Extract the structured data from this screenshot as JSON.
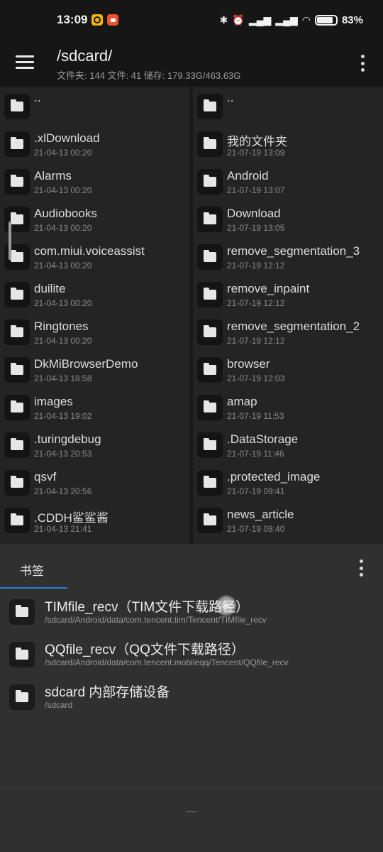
{
  "status_bar": {
    "time": "13:09",
    "icons": [
      "bluetooth-icon",
      "alarm-icon",
      "signal-hd-icon",
      "signal-hd-icon",
      "wifi-icon",
      "battery-icon"
    ],
    "battery_text": "83%",
    "battery_level": 0.83
  },
  "header": {
    "title": "/sdcard/",
    "subtitle": "文件夹: 144   文件: 41   储存: 179.33G/463.63G"
  },
  "left_column": [
    {
      "name": "..",
      "date": ""
    },
    {
      "name": ".xlDownload",
      "date": "21-04-13 00:20"
    },
    {
      "name": "Alarms",
      "date": "21-04-13 00:20"
    },
    {
      "name": "Audiobooks",
      "date": "21-04-13 00:20"
    },
    {
      "name": "com.miui.voiceassist",
      "date": "21-04-13 00:20"
    },
    {
      "name": "duilite",
      "date": "21-04-13 00:20"
    },
    {
      "name": "Ringtones",
      "date": "21-04-13 00:20"
    },
    {
      "name": "DkMiBrowserDemo",
      "date": "21-04-13 18:58"
    },
    {
      "name": "images",
      "date": "21-04-13 19:02"
    },
    {
      "name": ".turingdebug",
      "date": "21-04-13 20:53"
    },
    {
      "name": "qsvf",
      "date": "21-04-13 20:56"
    },
    {
      "name": ".CDDH鲨鲨酱",
      "date": "21-04-13 21:41"
    }
  ],
  "right_column": [
    {
      "name": "..",
      "date": ""
    },
    {
      "name": "我的文件夹",
      "date": "21-07-19 13:09"
    },
    {
      "name": "Android",
      "date": "21-07-19 13:07"
    },
    {
      "name": "Download",
      "date": "21-07-19 13:05"
    },
    {
      "name": "remove_segmentation_3",
      "date": "21-07-19 12:12"
    },
    {
      "name": "remove_inpaint",
      "date": "21-07-19 12:12"
    },
    {
      "name": "remove_segmentation_2",
      "date": "21-07-19 12:12"
    },
    {
      "name": "browser",
      "date": "21-07-19 12:03"
    },
    {
      "name": "amap",
      "date": "21-07-19 11:53"
    },
    {
      "name": ".DataStorage",
      "date": "21-07-19 11:46"
    },
    {
      "name": ".protected_image",
      "date": "21-07-19 09:41"
    },
    {
      "name": "news_article",
      "date": "21-07-19 08:40"
    }
  ],
  "bookmarks": {
    "tab_label": "书签",
    "items": [
      {
        "name": "TIMfile_recv（TIM文件下载路径）",
        "path": "/sdcard/Android/data/com.tencent.tim/Tencent/TIMfile_recv"
      },
      {
        "name": "QQfile_recv（QQ文件下载路径）",
        "path": "/sdcard/Android/data/com.tencent.mobileqq/Tencent/QQfile_recv"
      },
      {
        "name": "sdcard 内部存储设备",
        "path": "/sdcard"
      }
    ]
  }
}
